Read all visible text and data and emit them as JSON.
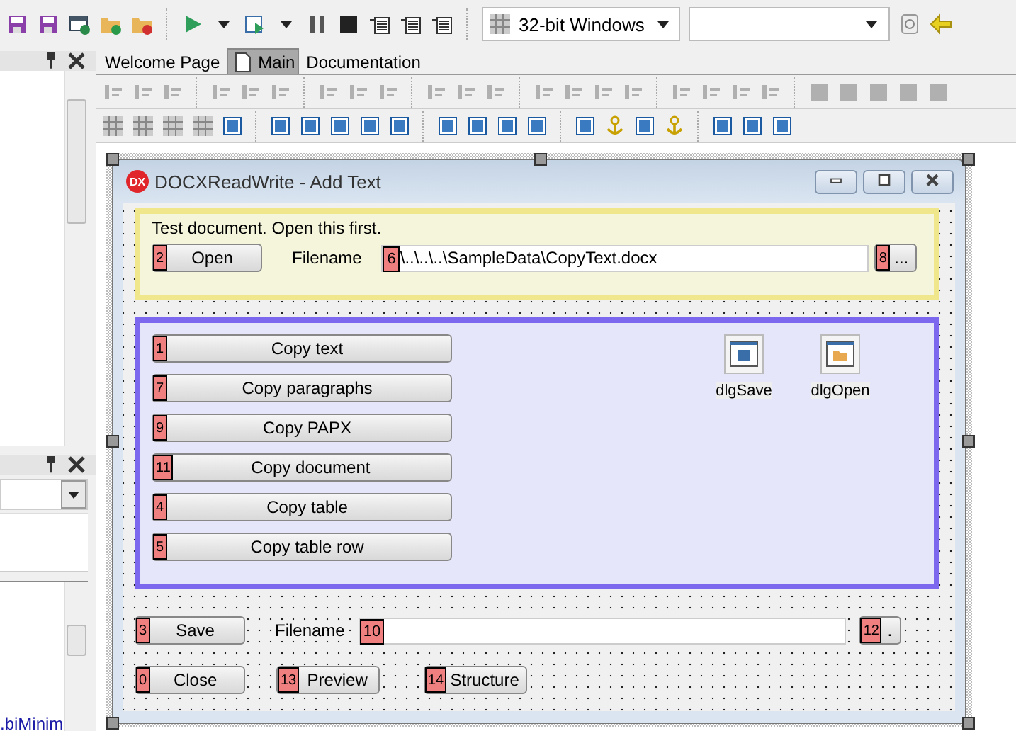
{
  "toolbar": {
    "platform": "32-bit Windows"
  },
  "left_panel": {
    "link_text": ".biMinim"
  },
  "tabs": [
    {
      "label": "Welcome Page",
      "selected": false
    },
    {
      "label": "Main",
      "selected": true
    },
    {
      "label": "Documentation",
      "selected": false
    }
  ],
  "form": {
    "logo": "DX",
    "title": "DOCXReadWrite - Add Text",
    "open_group": {
      "caption": "Test document. Open this first.",
      "open_button": {
        "label": "Open",
        "tag": "2"
      },
      "filename_label": "Filename",
      "filename": {
        "value": "\\..\\..\\..\\SampleData\\CopyText.docx",
        "tag": "6"
      },
      "browse_button": {
        "label": "...",
        "tag": "8"
      }
    },
    "copy_buttons": [
      {
        "label": "Copy text",
        "tag": "1"
      },
      {
        "label": "Copy paragraphs",
        "tag": "7"
      },
      {
        "label": "Copy PAPX",
        "tag": "9"
      },
      {
        "label": "Copy document",
        "tag": "11"
      },
      {
        "label": "Copy table",
        "tag": "4"
      },
      {
        "label": "Copy table row",
        "tag": "5"
      }
    ],
    "dialogs": [
      {
        "label": "dlgSave",
        "kind": "save"
      },
      {
        "label": "dlgOpen",
        "kind": "open"
      }
    ],
    "save_row": {
      "save_button": {
        "label": "Save",
        "tag": "3"
      },
      "filename_label": "Filename",
      "filename": {
        "tag": "10"
      },
      "browse_button": {
        "label": ".",
        "tag": "12"
      }
    },
    "bottom_buttons": [
      {
        "label": "Close",
        "tag": "0"
      },
      {
        "label": "Preview",
        "tag": "13"
      },
      {
        "label": "Structure",
        "tag": "14"
      }
    ]
  }
}
